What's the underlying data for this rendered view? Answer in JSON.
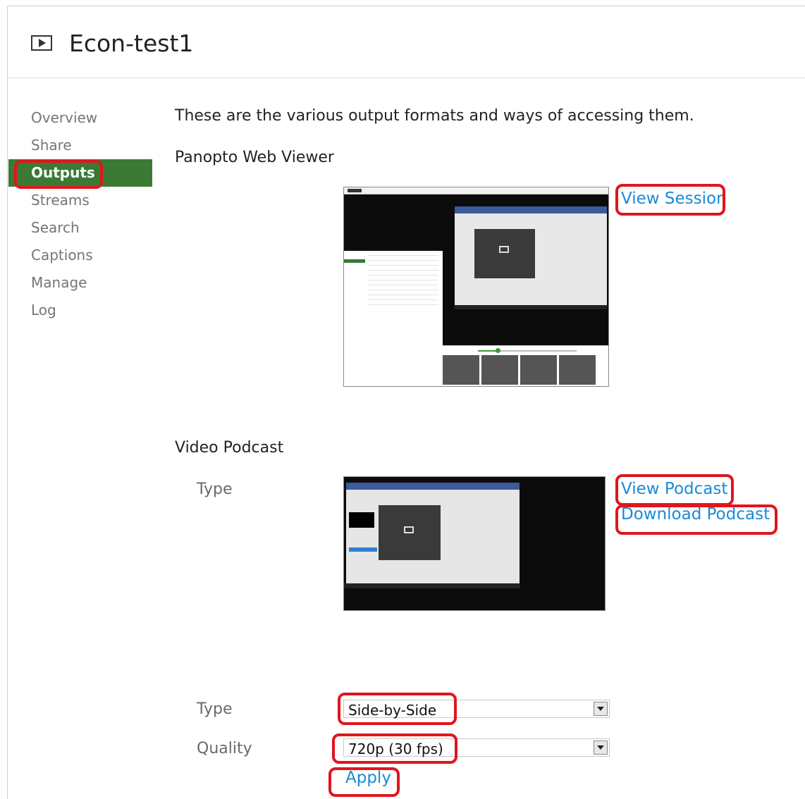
{
  "header": {
    "title": "Econ-test1",
    "icon": "play-icon"
  },
  "sidebar": {
    "items": [
      {
        "label": "Overview"
      },
      {
        "label": "Share"
      },
      {
        "label": "Outputs",
        "active": true
      },
      {
        "label": "Streams"
      },
      {
        "label": "Search"
      },
      {
        "label": "Captions"
      },
      {
        "label": "Manage"
      },
      {
        "label": "Log"
      }
    ]
  },
  "main": {
    "intro": "These are the various output formats and ways of accessing them.",
    "web_viewer": {
      "title": "Panopto Web Viewer",
      "view_link": "View Session"
    },
    "podcast": {
      "title": "Video Podcast",
      "type_label": "Type",
      "view_link": "View Podcast",
      "download_link": "Download Podcast"
    },
    "settings": {
      "type_label": "Type",
      "type_value": "Side-by-Side",
      "quality_label": "Quality",
      "quality_value": "720p (30 fps)",
      "apply_label": "Apply"
    }
  },
  "colors": {
    "accent_green": "#3a7a35",
    "link_blue": "#1a8ad4",
    "highlight_red": "#e0161d"
  }
}
